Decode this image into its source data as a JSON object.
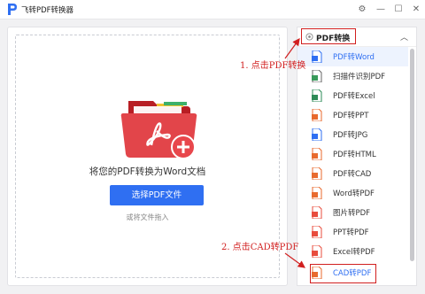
{
  "app": {
    "title": "飞转PDF转换器"
  },
  "window_controls": {
    "settings": "⚙",
    "minimize": "—",
    "maximize": "☐",
    "close": "✕"
  },
  "drop": {
    "hint": "将您的PDF转换为Word文档",
    "select_button": "选择PDF文件",
    "drag_hint": "或将文件拖入"
  },
  "sidebar": {
    "header": "PDF转换",
    "items": [
      {
        "label": "PDF转Word",
        "icon": "word-file-icon",
        "color": "#2f6ff2"
      },
      {
        "label": "扫描件识别PDF",
        "icon": "scan-file-icon",
        "color": "#3a9a5b"
      },
      {
        "label": "PDF转Excel",
        "icon": "excel-file-icon",
        "color": "#2e8b57"
      },
      {
        "label": "PDF转PPT",
        "icon": "ppt-file-icon",
        "color": "#e86a2e"
      },
      {
        "label": "PDF转JPG",
        "icon": "jpg-file-icon",
        "color": "#2f6ff2"
      },
      {
        "label": "PDF转HTML",
        "icon": "html-file-icon",
        "color": "#e86a2e"
      },
      {
        "label": "PDF转CAD",
        "icon": "cad-file-icon",
        "color": "#e86a2e"
      },
      {
        "label": "Word转PDF",
        "icon": "word-to-pdf-icon",
        "color": "#e86a2e"
      },
      {
        "label": "图片转PDF",
        "icon": "image-to-pdf-icon",
        "color": "#e84c3d"
      },
      {
        "label": "PPT转PDF",
        "icon": "ppt-to-pdf-icon",
        "color": "#e84c3d"
      },
      {
        "label": "Excel转PDF",
        "icon": "excel-to-pdf-icon",
        "color": "#e84c3d"
      },
      {
        "label": "CAD转PDF",
        "icon": "cad-to-pdf-icon",
        "color": "#e86a2e"
      }
    ]
  },
  "annotations": {
    "step1": "1. 点击PDF转换",
    "step2": "2. 点击CAD转PDF"
  }
}
